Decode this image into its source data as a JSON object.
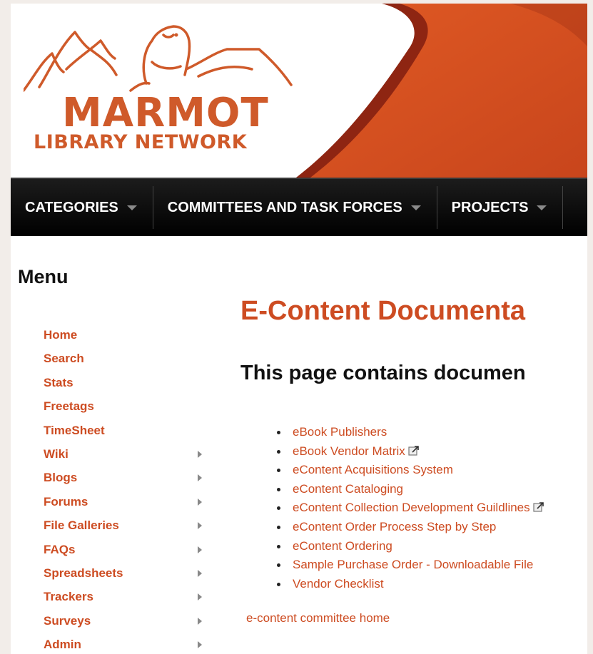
{
  "logo": {
    "line1": "MARMOT",
    "line2": "LIBRARY NETWORK"
  },
  "nav": {
    "items": [
      {
        "label": "CATEGORIES"
      },
      {
        "label": "COMMITTEES AND TASK FORCES"
      },
      {
        "label": "PROJECTS"
      }
    ]
  },
  "sidebar": {
    "title": "Menu",
    "items": [
      {
        "label": "Home",
        "has_submenu": false
      },
      {
        "label": "Search",
        "has_submenu": false
      },
      {
        "label": "Stats",
        "has_submenu": false
      },
      {
        "label": "Freetags",
        "has_submenu": false
      },
      {
        "label": "TimeSheet",
        "has_submenu": false
      },
      {
        "label": "Wiki",
        "has_submenu": true
      },
      {
        "label": "Blogs",
        "has_submenu": true
      },
      {
        "label": "Forums",
        "has_submenu": true
      },
      {
        "label": "File Galleries",
        "has_submenu": true
      },
      {
        "label": "FAQs",
        "has_submenu": true
      },
      {
        "label": "Spreadsheets",
        "has_submenu": true
      },
      {
        "label": "Trackers",
        "has_submenu": true
      },
      {
        "label": "Surveys",
        "has_submenu": true
      },
      {
        "label": "Admin",
        "has_submenu": true
      }
    ]
  },
  "main": {
    "title": "E-Content Documenta",
    "subtitle": "This page contains documen",
    "documents": [
      {
        "label": "eBook Publishers",
        "external": false
      },
      {
        "label": "eBook Vendor Matrix",
        "external": true
      },
      {
        "label": "eContent Acquisitions System",
        "external": false
      },
      {
        "label": "eContent Cataloging",
        "external": false
      },
      {
        "label": "eContent Collection Development Guildlines",
        "external": true
      },
      {
        "label": "eContent Order Process Step by Step",
        "external": false
      },
      {
        "label": "eContent Ordering",
        "external": false
      },
      {
        "label": "Sample Purchase Order - Downloadable File",
        "external": false
      },
      {
        "label": "Vendor Checklist",
        "external": false
      }
    ],
    "home_link": "e-content committee home"
  },
  "colors": {
    "accent": "#cd4c22",
    "nav_bg": "#000000",
    "page_bg": "#f2ede9"
  }
}
